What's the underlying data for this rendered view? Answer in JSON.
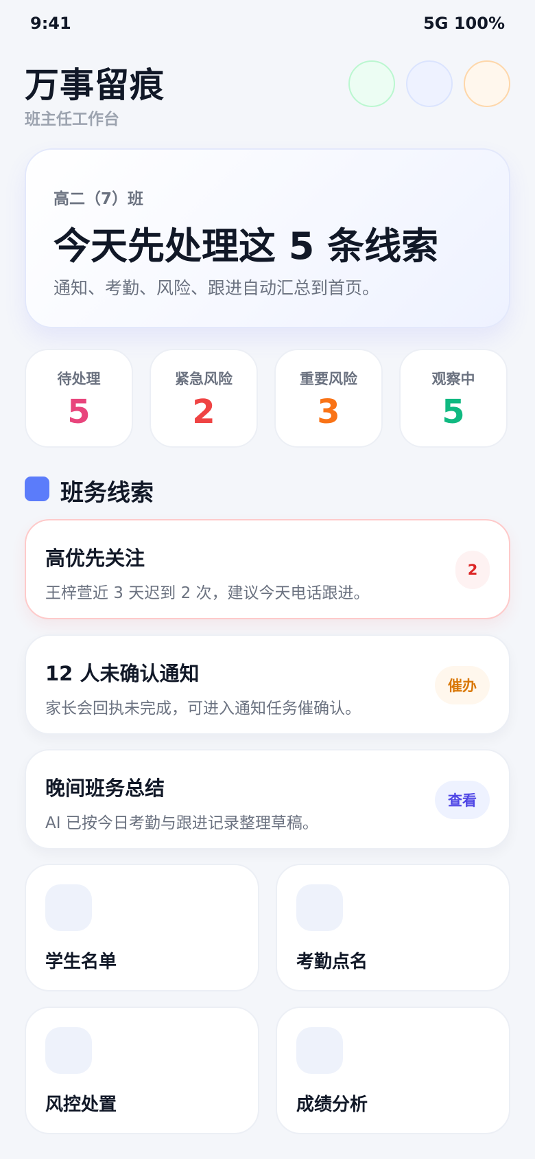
{
  "status_bar": {
    "time": "9:41",
    "network_battery": "5G 100%"
  },
  "header": {
    "title": "万事留痕",
    "subtitle": "班主任工作台",
    "circles": [
      "green-circle-icon",
      "blue-circle-icon",
      "orange-circle-icon"
    ]
  },
  "hero": {
    "class_name": "高二（7）班",
    "headline": "今天先处理这 5 条线索",
    "description": "通知、考勤、风险、跟进自动汇总到首页。"
  },
  "stats": [
    {
      "label": "待处理",
      "value": "5",
      "color": "#e8457c"
    },
    {
      "label": "紧急风险",
      "value": "2",
      "color": "#ef4444"
    },
    {
      "label": "重要风险",
      "value": "3",
      "color": "#f97316"
    },
    {
      "label": "观察中",
      "value": "5",
      "color": "#10b981"
    }
  ],
  "section": {
    "title": "班务线索",
    "marker_color": "#5b7cfa"
  },
  "tasks": [
    {
      "title": "高优先关注",
      "description": "王梓萱近 3 天迟到 2 次，建议今天电话跟进。",
      "badge": "2"
    },
    {
      "title": "12 人未确认通知",
      "description": "家长会回执未完成，可进入通知任务催确认。",
      "badge": "催办"
    },
    {
      "title": "晚间班务总结",
      "description": "AI 已按今日考勤与跟进记录整理草稿。",
      "badge": "查看"
    }
  ],
  "quick_actions": [
    {
      "label": "学生名单"
    },
    {
      "label": "考勤点名"
    },
    {
      "label": "风控处置"
    },
    {
      "label": "成绩分析"
    }
  ]
}
